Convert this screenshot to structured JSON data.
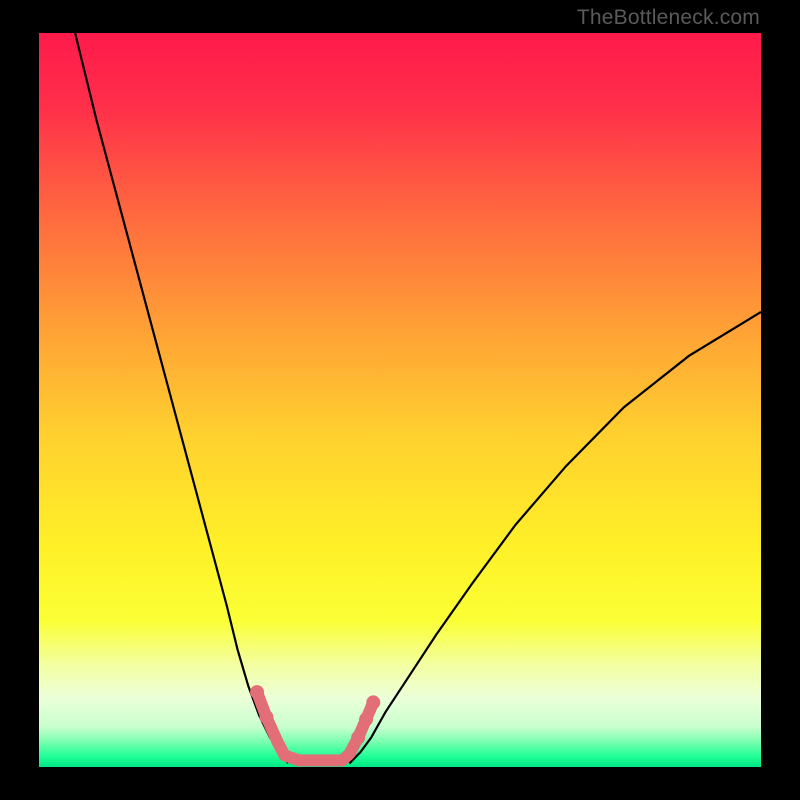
{
  "watermark": {
    "text": "TheBottleneck.com"
  },
  "chart_data": {
    "type": "line",
    "title": "",
    "xlabel": "",
    "ylabel": "",
    "xlim": [
      0,
      100
    ],
    "ylim": [
      0,
      100
    ],
    "background_gradient": {
      "stops": [
        {
          "pos": 0.0,
          "color": "#ff1a4b"
        },
        {
          "pos": 0.1,
          "color": "#ff2f4a"
        },
        {
          "pos": 0.25,
          "color": "#ff6a3f"
        },
        {
          "pos": 0.4,
          "color": "#ffa036"
        },
        {
          "pos": 0.55,
          "color": "#ffd12f"
        },
        {
          "pos": 0.7,
          "color": "#fff028"
        },
        {
          "pos": 0.8,
          "color": "#fbff35"
        },
        {
          "pos": 0.86,
          "color": "#f3ffa0"
        },
        {
          "pos": 0.905,
          "color": "#ecffd8"
        },
        {
          "pos": 0.945,
          "color": "#c9ffcf"
        },
        {
          "pos": 0.965,
          "color": "#7cffb0"
        },
        {
          "pos": 0.985,
          "color": "#23ff99"
        },
        {
          "pos": 1.0,
          "color": "#00e884"
        }
      ]
    },
    "series": [
      {
        "name": "left-curve",
        "stroke": "#000000",
        "x": [
          5,
          8,
          11,
          14,
          17,
          20,
          23,
          26,
          27.5,
          29,
          30.5,
          32,
          33.5,
          34.5
        ],
        "y": [
          100,
          88,
          77,
          66,
          55,
          44,
          33,
          22,
          16,
          11,
          7,
          4,
          2,
          0.5
        ]
      },
      {
        "name": "right-curve",
        "stroke": "#000000",
        "x": [
          43,
          44.5,
          46,
          48,
          51,
          55,
          60,
          66,
          73,
          81,
          90,
          100
        ],
        "y": [
          0.5,
          2,
          4,
          7.5,
          12,
          18,
          25,
          33,
          41,
          49,
          56,
          62
        ]
      },
      {
        "name": "bottom-marker-path",
        "stroke": "#e26f77",
        "stroke_width": 12,
        "linecap": "round",
        "x": [
          30.2,
          31.5,
          33,
          34,
          36,
          40,
          42,
          43,
          44.2,
          45.3,
          46.3
        ],
        "y": [
          10.2,
          6.8,
          3.5,
          1.6,
          0.9,
          0.9,
          0.9,
          1.8,
          4.0,
          6.5,
          8.8
        ]
      }
    ],
    "markers": [
      {
        "x": 30.2,
        "y": 10.2,
        "r": 7,
        "fill": "#e26f77"
      },
      {
        "x": 31.5,
        "y": 6.8,
        "r": 7,
        "fill": "#e26f77"
      },
      {
        "x": 44.2,
        "y": 4.0,
        "r": 7,
        "fill": "#e26f77"
      },
      {
        "x": 45.3,
        "y": 6.5,
        "r": 7,
        "fill": "#e26f77"
      },
      {
        "x": 46.3,
        "y": 8.8,
        "r": 7,
        "fill": "#e26f77"
      }
    ]
  }
}
